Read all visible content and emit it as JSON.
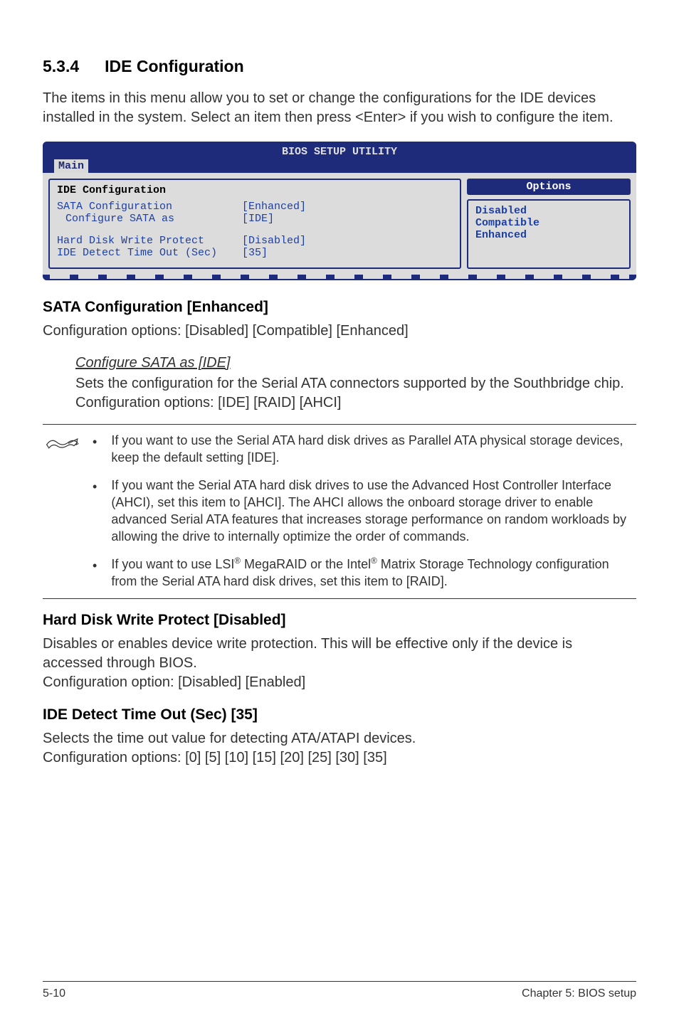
{
  "section": {
    "number": "5.3.4",
    "title": "IDE Configuration"
  },
  "intro": "The items in this menu allow you to set or change the configurations for the IDE devices installed in the system. Select an item then press <Enter> if you wish to configure the item.",
  "bios": {
    "title": "BIOS SETUP UTILITY",
    "tab": "Main",
    "panel_title": "IDE Configuration",
    "rows": [
      {
        "label": "SATA Configuration",
        "value": "[Enhanced]",
        "indent": false
      },
      {
        "label": "Configure SATA as",
        "value": "[IDE]",
        "indent": true
      },
      {
        "label": "",
        "value": "",
        "indent": false
      },
      {
        "label": "Hard Disk Write Protect",
        "value": "[Disabled]",
        "indent": false
      },
      {
        "label": "IDE Detect Time Out (Sec)",
        "value": "[35]",
        "indent": false
      }
    ],
    "options_title": "Options",
    "options": [
      "Disabled",
      "Compatible",
      "Enhanced"
    ]
  },
  "sub1": {
    "heading": "SATA Configuration [Enhanced]",
    "body": "Configuration options: [Disabled] [Compatible] [Enhanced]",
    "cfg_title": "Configure SATA as [IDE]",
    "cfg_body": "Sets the configuration for the Serial ATA connectors supported by the Southbridge chip. Configuration options: [IDE] [RAID] [AHCI]"
  },
  "note": {
    "bullet1": "If you want to use the Serial ATA hard disk drives as Parallel ATA physical storage devices, keep the default setting [IDE].",
    "bullet2": "If you want the Serial ATA hard disk drives to use the Advanced Host Controller Interface (AHCI), set this item to [AHCI]. The AHCI allows the onboard storage driver to enable advanced Serial ATA features that increases storage performance on random workloads by allowing the drive to internally optimize the order of commands.",
    "bullet3_pre": "If you want to use LSI",
    "bullet3_mid": " MegaRAID or the Intel",
    "bullet3_post": " Matrix Storage Technology configuration from the Serial ATA hard disk drives, set this item to [RAID]."
  },
  "sub2": {
    "heading": "Hard Disk Write Protect [Disabled]",
    "body1": "Disables or enables device write protection. This will be effective only if the device is accessed through BIOS.",
    "body2": "Configuration option: [Disabled] [Enabled]"
  },
  "sub3": {
    "heading": "IDE Detect Time Out (Sec) [35]",
    "body1": "Selects the time out value for detecting ATA/ATAPI devices.",
    "body2": "Configuration options: [0] [5] [10] [15] [20] [25] [30] [35]"
  },
  "footer": {
    "left": "5-10",
    "right": "Chapter 5: BIOS setup"
  }
}
